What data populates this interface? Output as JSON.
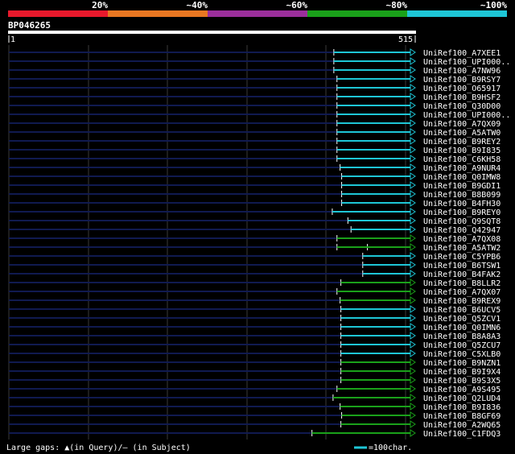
{
  "legend": {
    "bins": [
      {
        "label": "20%",
        "color": "#e8192c"
      },
      {
        "label": "~40%",
        "color": "#e87722"
      },
      {
        "label": "~60%",
        "color": "#9b2f9b"
      },
      {
        "label": "~80%",
        "color": "#1aa11a"
      },
      {
        "label": "~100%",
        "color": "#1ec6d6"
      }
    ]
  },
  "query": {
    "id": "BP046265",
    "start": "1",
    "end": "515"
  },
  "footer": {
    "gaps_note": "Large gaps: ▲(in Query)/– (in Subject)",
    "scale_note": "=100char."
  },
  "colors": {
    "background": "#000000",
    "query_bar": "#ffffff",
    "track": "#101a50",
    "grid": "#3a3a3a",
    "cyan": "#1ec6d6",
    "green": "#1aa11a"
  },
  "chart_data": {
    "type": "alignment",
    "query_length": 515,
    "hits": [
      {
        "id": "UniRef100_A7XEE1",
        "start": 417,
        "end": 515,
        "color": "cyan"
      },
      {
        "id": "UniRef100_UPI000..",
        "start": 417,
        "end": 515,
        "color": "cyan"
      },
      {
        "id": "UniRef100_A7NW96",
        "start": 417,
        "end": 515,
        "color": "cyan"
      },
      {
        "id": "UniRef100_B9RSY7",
        "start": 421,
        "end": 515,
        "color": "cyan"
      },
      {
        "id": "UniRef100_O65917",
        "start": 421,
        "end": 515,
        "color": "cyan"
      },
      {
        "id": "UniRef100_B9HSF2",
        "start": 421,
        "end": 515,
        "color": "cyan"
      },
      {
        "id": "UniRef100_Q30D00",
        "start": 421,
        "end": 515,
        "color": "cyan"
      },
      {
        "id": "UniRef100_UPI000..",
        "start": 421,
        "end": 515,
        "color": "cyan"
      },
      {
        "id": "UniRef100_A7QX09",
        "start": 421,
        "end": 515,
        "color": "cyan"
      },
      {
        "id": "UniRef100_A5ATW0",
        "start": 421,
        "end": 515,
        "color": "cyan"
      },
      {
        "id": "UniRef100_B9REY2",
        "start": 421,
        "end": 515,
        "color": "cyan"
      },
      {
        "id": "UniRef100_B9I835",
        "start": 421,
        "end": 515,
        "color": "cyan"
      },
      {
        "id": "UniRef100_C6KH58",
        "start": 421,
        "end": 515,
        "color": "cyan"
      },
      {
        "id": "UniRef100_A9NUR4",
        "start": 425,
        "end": 515,
        "color": "cyan"
      },
      {
        "id": "UniRef100_Q0IMW8",
        "start": 427,
        "end": 515,
        "color": "cyan"
      },
      {
        "id": "UniRef100_B9GDI1",
        "start": 427,
        "end": 515,
        "color": "cyan"
      },
      {
        "id": "UniRef100_B8B099",
        "start": 427,
        "end": 515,
        "color": "cyan"
      },
      {
        "id": "UniRef100_B4FH30",
        "start": 427,
        "end": 515,
        "color": "cyan"
      },
      {
        "id": "UniRef100_B9REY0",
        "start": 415,
        "end": 515,
        "color": "cyan"
      },
      {
        "id": "UniRef100_Q9SQT8",
        "start": 435,
        "end": 515,
        "color": "cyan"
      },
      {
        "id": "UniRef100_Q42947",
        "start": 439,
        "end": 515,
        "color": "cyan"
      },
      {
        "id": "UniRef100_A7QX08",
        "start": 421,
        "end": 515,
        "color": "green"
      },
      {
        "id": "UniRef100_A5ATW2",
        "start": 421,
        "end": 515,
        "color": "green",
        "split": 460
      },
      {
        "id": "UniRef100_C5YPB6",
        "start": 454,
        "end": 515,
        "color": "cyan"
      },
      {
        "id": "UniRef100_B6TSW1",
        "start": 454,
        "end": 515,
        "color": "cyan"
      },
      {
        "id": "UniRef100_B4FAK2",
        "start": 454,
        "end": 515,
        "color": "cyan"
      },
      {
        "id": "UniRef100_B8LLR2",
        "start": 426,
        "end": 515,
        "color": "green"
      },
      {
        "id": "UniRef100_A7QX07",
        "start": 421,
        "end": 515,
        "color": "green"
      },
      {
        "id": "UniRef100_B9REX9",
        "start": 425,
        "end": 515,
        "color": "green"
      },
      {
        "id": "UniRef100_B6UCV5",
        "start": 426,
        "end": 515,
        "color": "cyan"
      },
      {
        "id": "UniRef100_Q5ZCV1",
        "start": 426,
        "end": 515,
        "color": "cyan"
      },
      {
        "id": "UniRef100_Q0IMN6",
        "start": 426,
        "end": 515,
        "color": "cyan"
      },
      {
        "id": "UniRef100_B8A8A3",
        "start": 426,
        "end": 515,
        "color": "cyan"
      },
      {
        "id": "UniRef100_Q5ZCU7",
        "start": 426,
        "end": 515,
        "color": "cyan"
      },
      {
        "id": "UniRef100_C5XLB0",
        "start": 426,
        "end": 515,
        "color": "cyan"
      },
      {
        "id": "UniRef100_B9NZN1",
        "start": 426,
        "end": 515,
        "color": "green"
      },
      {
        "id": "UniRef100_B9I9X4",
        "start": 426,
        "end": 515,
        "color": "green"
      },
      {
        "id": "UniRef100_B9S3X5",
        "start": 426,
        "end": 515,
        "color": "green"
      },
      {
        "id": "UniRef100_A9S495",
        "start": 421,
        "end": 515,
        "color": "green"
      },
      {
        "id": "UniRef100_Q2LUD4",
        "start": 416,
        "end": 515,
        "color": "green"
      },
      {
        "id": "UniRef100_B9I836",
        "start": 425,
        "end": 515,
        "color": "green"
      },
      {
        "id": "UniRef100_B8GF69",
        "start": 427,
        "end": 515,
        "color": "green"
      },
      {
        "id": "UniRef100_A2WQ65",
        "start": 426,
        "end": 515,
        "color": "green"
      },
      {
        "id": "UniRef100_C1FDQ3",
        "start": 389,
        "end": 515,
        "color": "green"
      }
    ]
  }
}
